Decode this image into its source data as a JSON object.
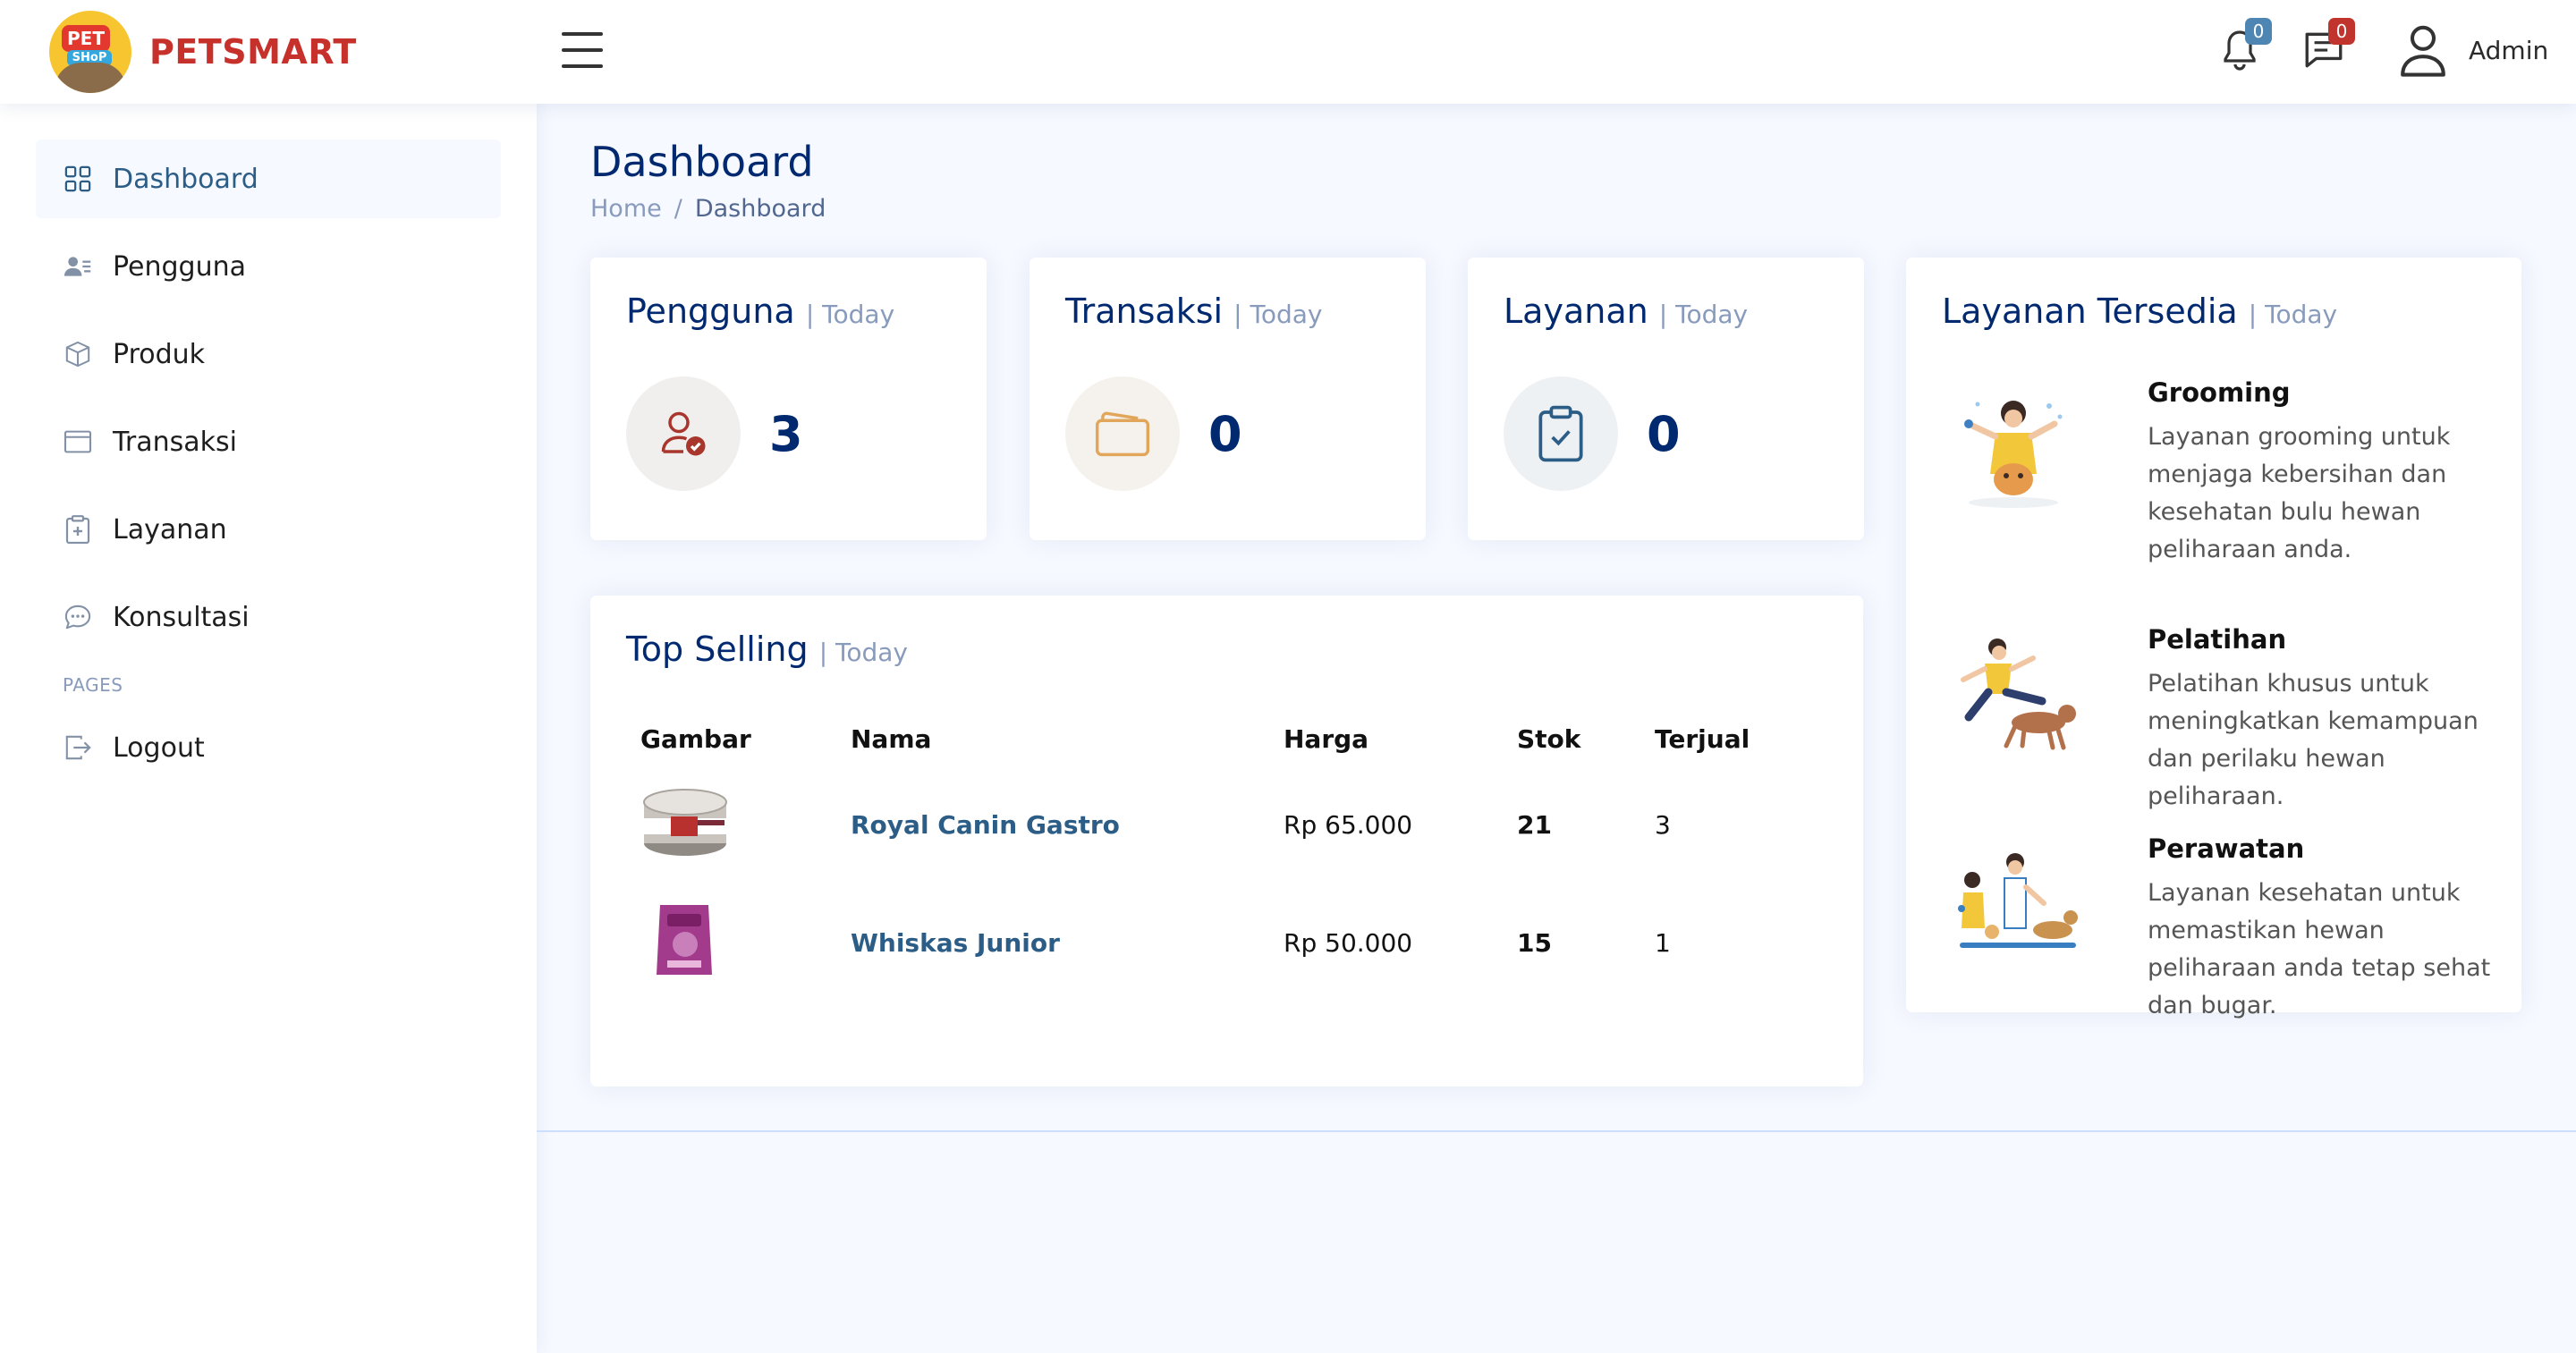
{
  "brand": {
    "logo_pet": "PET",
    "logo_shop": "SHoP",
    "name": "PETSMART"
  },
  "header": {
    "notifications": {
      "count": "0",
      "icon": "bell-icon"
    },
    "messages": {
      "count": "0",
      "icon": "chat-icon"
    },
    "profile": {
      "name": "Admin",
      "icon": "person-icon"
    }
  },
  "sidebar": {
    "items": [
      {
        "label": "Dashboard",
        "icon": "grid-icon",
        "active": true
      },
      {
        "label": "Pengguna",
        "icon": "people-icon"
      },
      {
        "label": "Produk",
        "icon": "box-icon"
      },
      {
        "label": "Transaksi",
        "icon": "window-icon"
      },
      {
        "label": "Layanan",
        "icon": "clipboard-plus-icon"
      },
      {
        "label": "Konsultasi",
        "icon": "chat-dots-icon"
      }
    ],
    "section_heading": "PAGES",
    "logout": {
      "label": "Logout",
      "icon": "logout-icon"
    }
  },
  "page": {
    "title": "Dashboard",
    "breadcrumb": [
      "Home",
      "Dashboard"
    ]
  },
  "stats": [
    {
      "title": "Pengguna",
      "period": "| Today",
      "value": "3",
      "icon": "person-check-icon",
      "color": "#a8362c",
      "bg": "#f1efee"
    },
    {
      "title": "Transaksi",
      "period": "| Today",
      "value": "0",
      "icon": "wallet-icon",
      "color": "#e2a65b",
      "bg": "#f5f2ee"
    },
    {
      "title": "Layanan",
      "period": "| Today",
      "value": "0",
      "icon": "clipboard-check-icon",
      "color": "#2c5d86",
      "bg": "#eef1f4"
    }
  ],
  "top_selling": {
    "title": "Top Selling",
    "period": "| Today",
    "columns": [
      "Gambar",
      "Nama",
      "Harga",
      "Stok",
      "Terjual"
    ],
    "rows": [
      {
        "name": "Royal Canin Gastro",
        "price": "Rp 65.000",
        "stock": "21",
        "sold": "3",
        "image": "can-food-image"
      },
      {
        "name": "Whiskas Junior",
        "price": "Rp 50.000",
        "stock": "15",
        "sold": "1",
        "image": "food-bag-image"
      }
    ]
  },
  "services": {
    "title": "Layanan Tersedia",
    "period": "| Today",
    "items": [
      {
        "name": "Grooming",
        "desc": "Layanan grooming untuk menjaga kebersihan dan kesehatan bulu hewan peliharaan anda.",
        "image": "grooming-illustration"
      },
      {
        "name": "Pelatihan",
        "desc": "Pelatihan khusus untuk meningkatkan kemampuan dan perilaku hewan peliharaan.",
        "image": "training-illustration"
      },
      {
        "name": "Perawatan",
        "desc": "Layanan kesehatan untuk memastikan hewan peliharaan anda tetap sehat dan bugar.",
        "image": "vet-care-illustration"
      }
    ]
  },
  "colors": {
    "accent": "#2c5d86",
    "title": "#012970",
    "muted": "#899bbd",
    "brand": "#c6322b"
  }
}
